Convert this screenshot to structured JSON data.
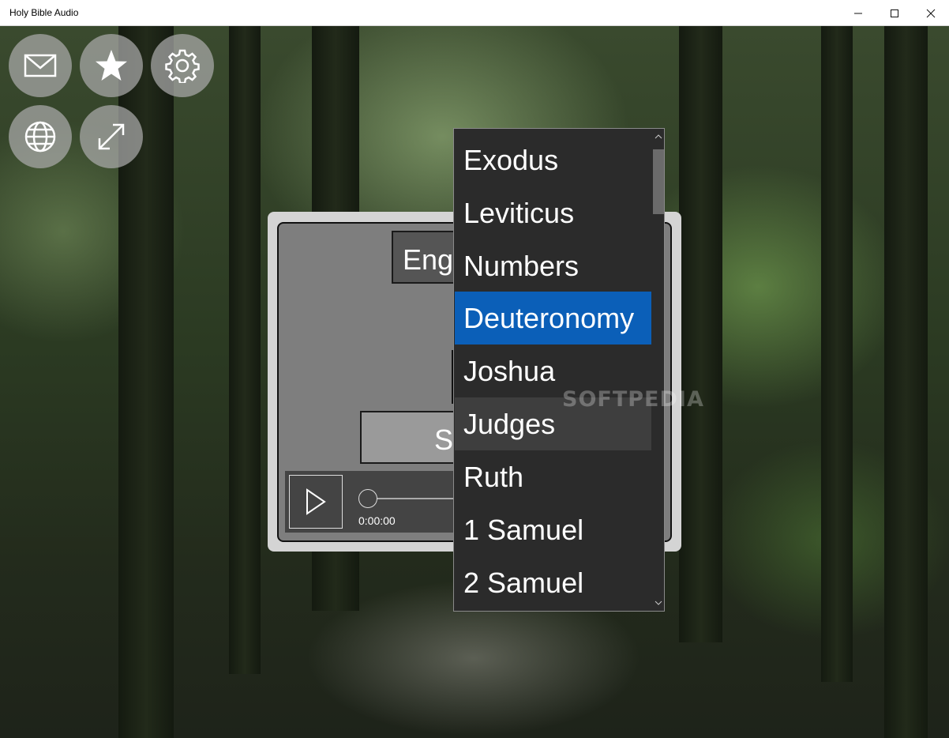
{
  "window": {
    "title": "Holy Bible Audio",
    "minimize": "—",
    "maximize": "☐",
    "close": "✕"
  },
  "toolbar": {
    "buttons": [
      {
        "icon": "mail-icon"
      },
      {
        "icon": "star-icon"
      },
      {
        "icon": "gear-icon"
      },
      {
        "icon": "globe-icon"
      },
      {
        "icon": "expand-icon"
      }
    ]
  },
  "panel": {
    "language_label": "Eng",
    "submit_label": "Su",
    "player": {
      "time": "0:00:00",
      "progress": 0
    }
  },
  "book_dropdown": {
    "items": [
      "Exodus",
      "Leviticus",
      "Numbers",
      "Deuteronomy",
      "Joshua",
      "Judges",
      "Ruth",
      "1 Samuel",
      "2 Samuel"
    ],
    "selected": "Deuteronomy",
    "hovered": "Judges"
  },
  "watermark": "SOFTPEDIA",
  "colors": {
    "selection": "#0b5fb8",
    "dropdown_bg": "#2b2b2b",
    "round_button": "#aaaaaa"
  }
}
